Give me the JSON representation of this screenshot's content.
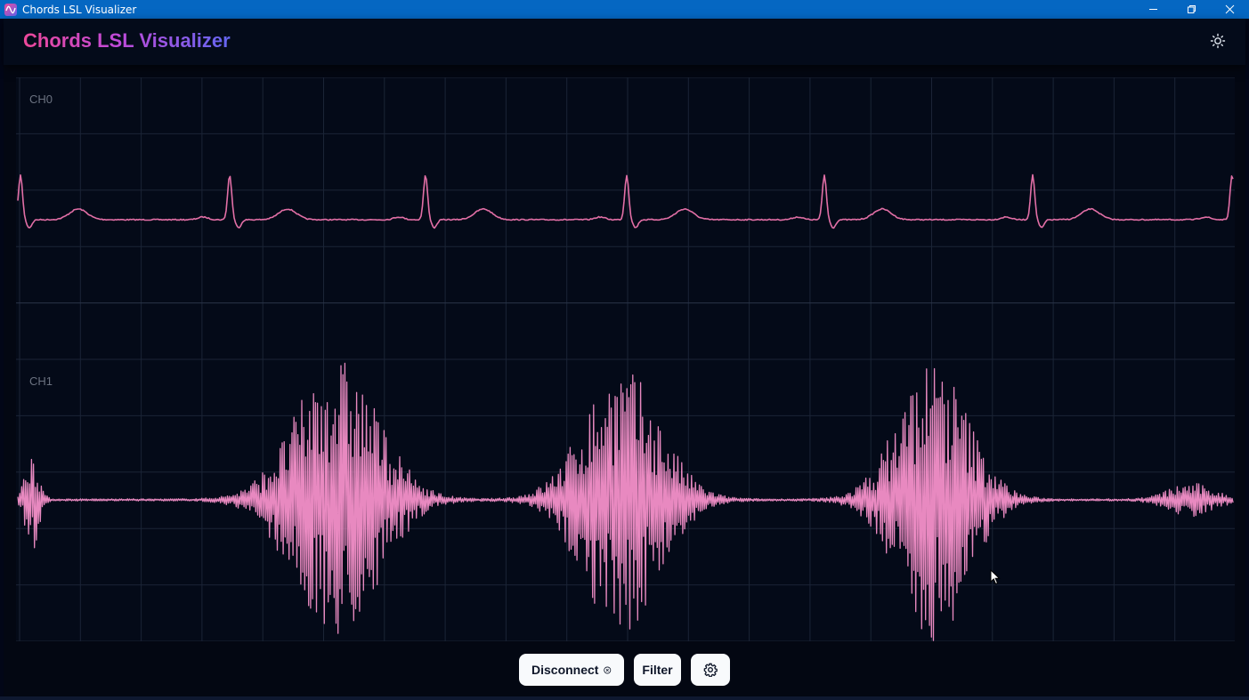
{
  "window": {
    "title": "Chords LSL Visualizer"
  },
  "header": {
    "app_title": "Chords LSL Visualizer"
  },
  "channels": [
    {
      "label": "CH0",
      "color": "#e26fa6"
    },
    {
      "label": "CH1",
      "color": "#e889c0"
    }
  ],
  "controls": {
    "disconnect_label": "Disconnect",
    "filter_label": "Filter"
  },
  "icons": {
    "app": "waveform-icon",
    "theme": "sun-icon",
    "disconnect": "close-circle-icon",
    "settings": "gear-icon",
    "minimize": "minimize-icon",
    "restore": "restore-icon",
    "close": "close-icon"
  },
  "colors": {
    "background": "#020617",
    "titlebar": "#0567c2",
    "accent_start": "#ec4899",
    "accent_end": "#6366f1"
  }
}
